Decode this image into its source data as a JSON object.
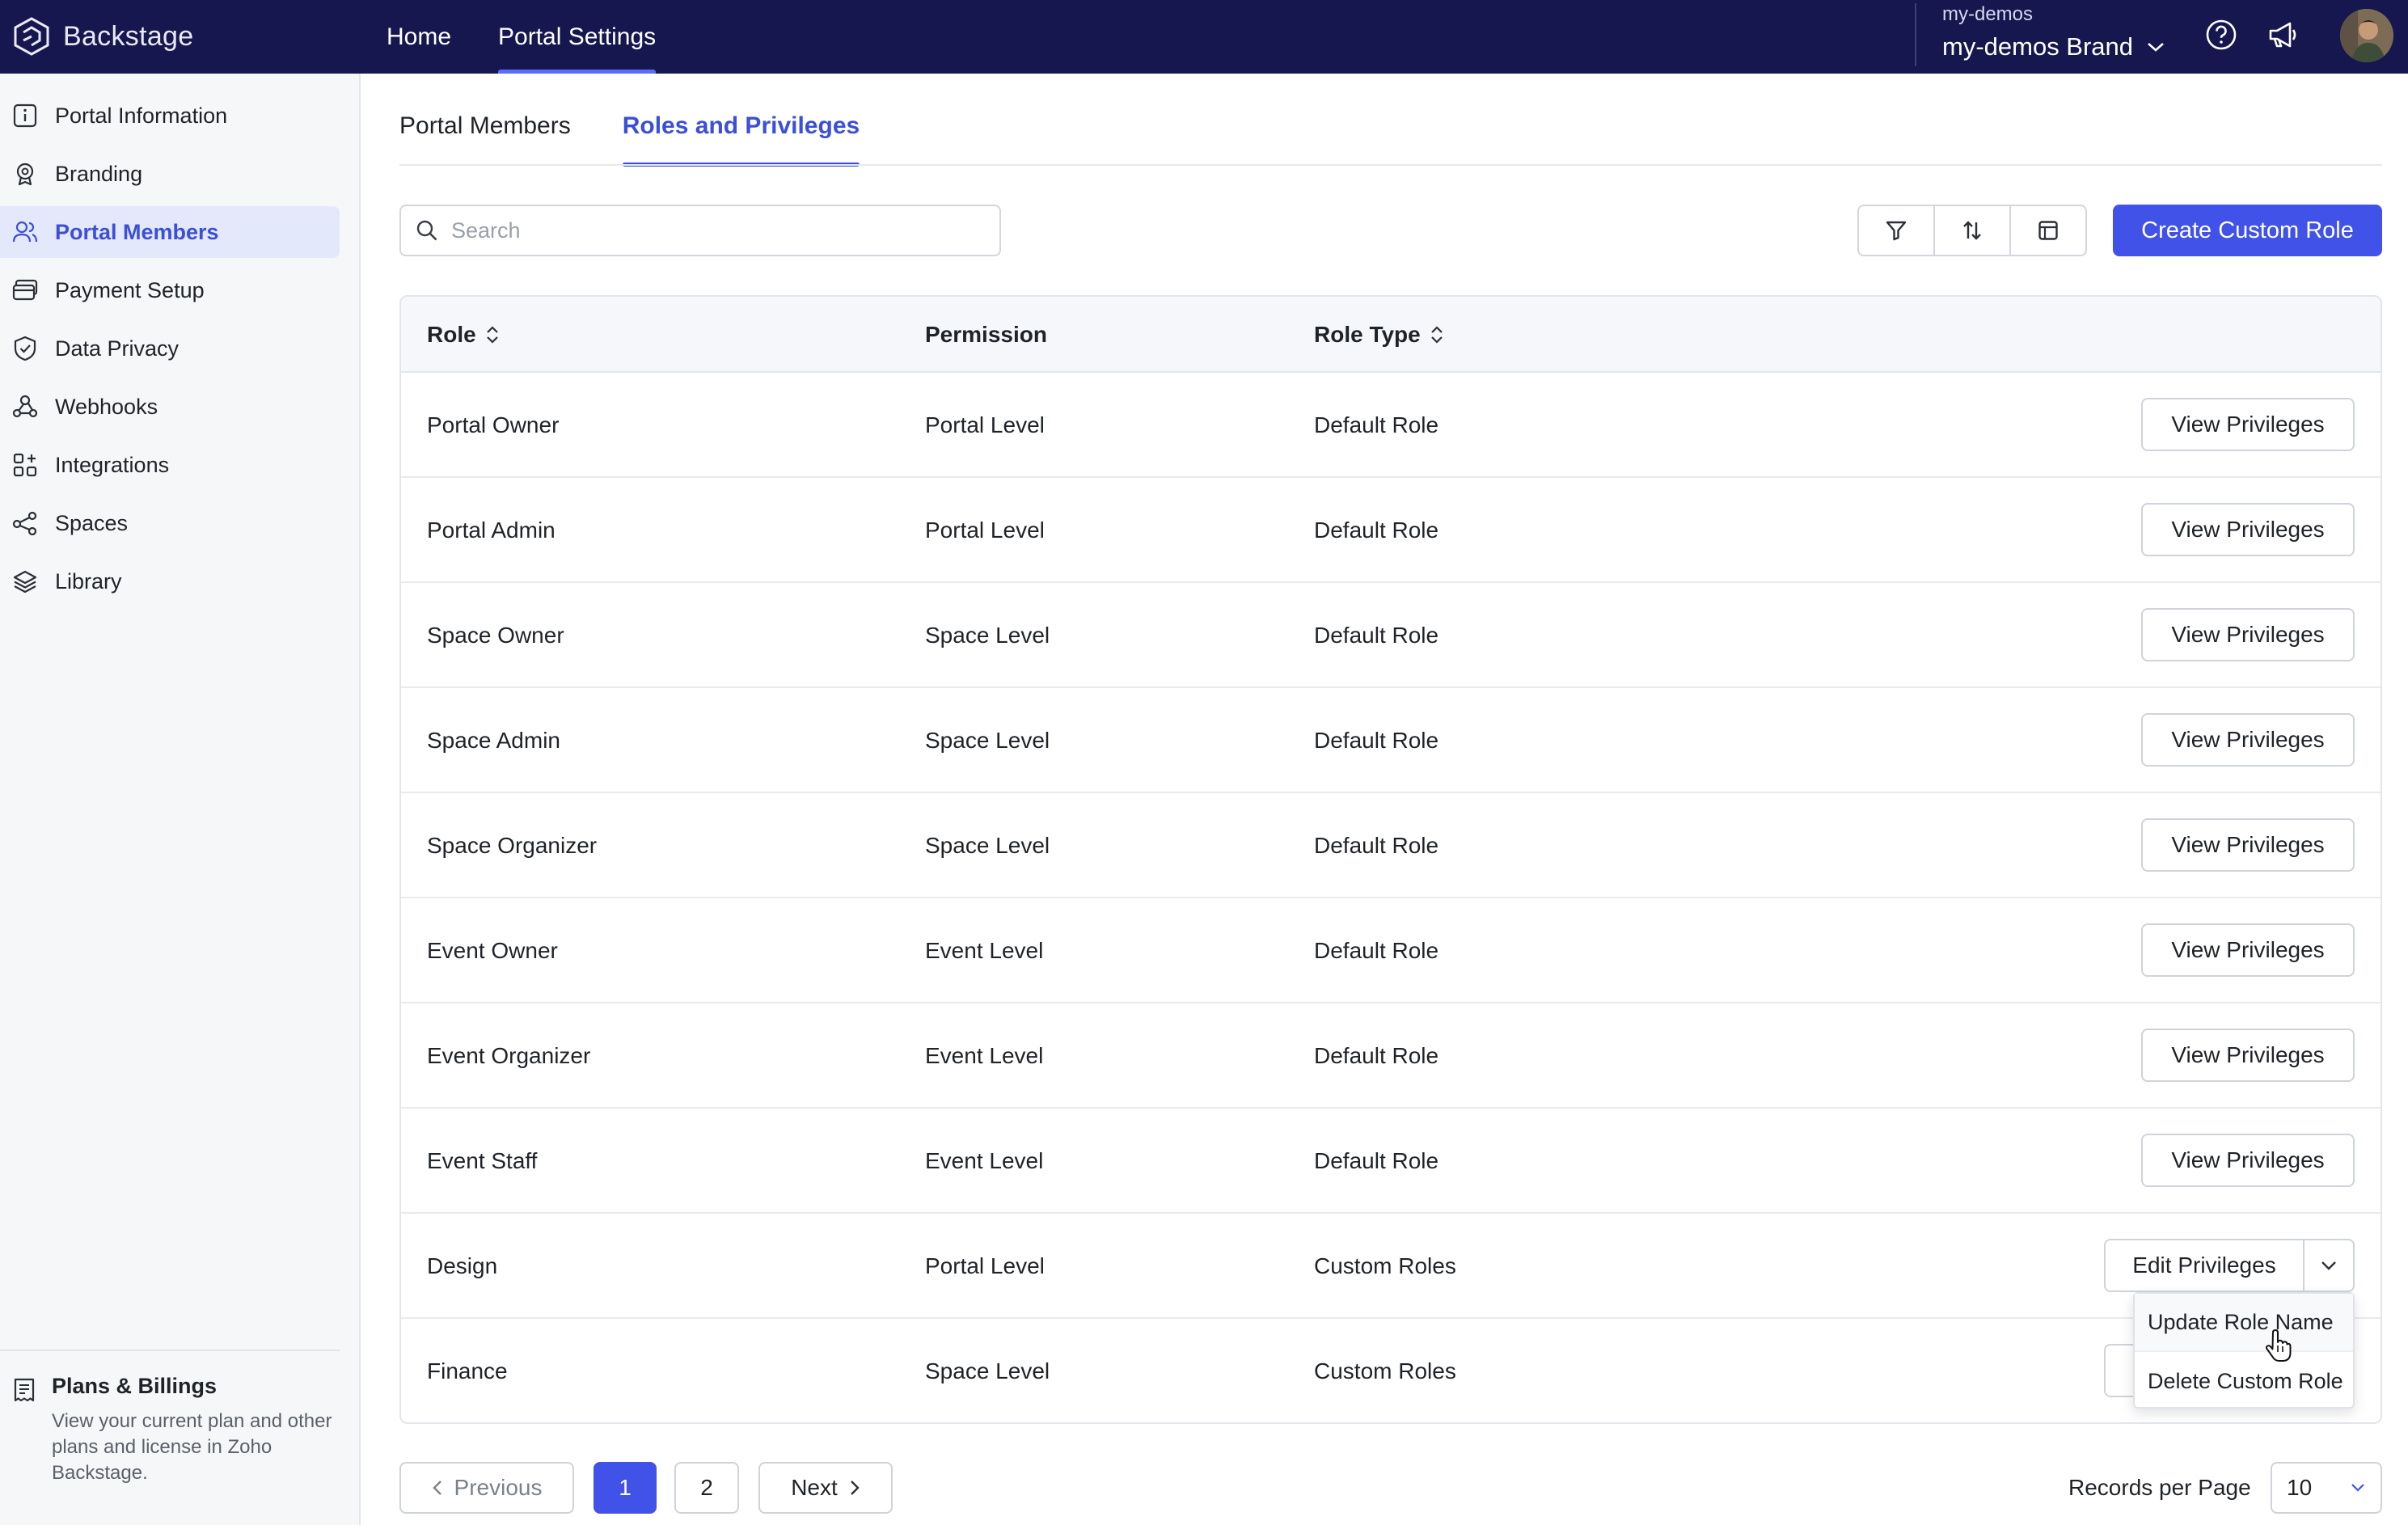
{
  "app": {
    "name": "Backstage"
  },
  "topnav": {
    "items": [
      {
        "label": "Home"
      },
      {
        "label": "Portal Settings"
      }
    ]
  },
  "account": {
    "org": "my-demos",
    "brand": "my-demos Brand"
  },
  "sidebar": {
    "items": [
      {
        "label": "Portal Information",
        "icon": "info-icon"
      },
      {
        "label": "Branding",
        "icon": "badge-icon"
      },
      {
        "label": "Portal Members",
        "icon": "users-icon"
      },
      {
        "label": "Payment Setup",
        "icon": "card-icon"
      },
      {
        "label": "Data Privacy",
        "icon": "shield-icon"
      },
      {
        "label": "Webhooks",
        "icon": "webhook-icon"
      },
      {
        "label": "Integrations",
        "icon": "grid-plus-icon"
      },
      {
        "label": "Spaces",
        "icon": "nodes-icon"
      },
      {
        "label": "Library",
        "icon": "layers-icon"
      }
    ],
    "active_index": 2,
    "plans": {
      "title": "Plans & Billings",
      "description": "View your current plan and other plans and license in Zoho Backstage."
    }
  },
  "tabs": [
    {
      "label": "Portal Members"
    },
    {
      "label": "Roles and Privileges"
    }
  ],
  "search": {
    "placeholder": "Search",
    "value": ""
  },
  "toolbar": {
    "create_label": "Create Custom Role"
  },
  "table": {
    "headers": {
      "role": "Role",
      "permission": "Permission",
      "role_type": "Role Type"
    },
    "rows": [
      {
        "role": "Portal Owner",
        "permission": "Portal Level",
        "role_type": "Default Role",
        "action": "View Privileges"
      },
      {
        "role": "Portal Admin",
        "permission": "Portal Level",
        "role_type": "Default Role",
        "action": "View Privileges"
      },
      {
        "role": "Space Owner",
        "permission": "Space Level",
        "role_type": "Default Role",
        "action": "View Privileges"
      },
      {
        "role": "Space Admin",
        "permission": "Space Level",
        "role_type": "Default Role",
        "action": "View Privileges"
      },
      {
        "role": "Space Organizer",
        "permission": "Space Level",
        "role_type": "Default Role",
        "action": "View Privileges"
      },
      {
        "role": "Event Owner",
        "permission": "Event Level",
        "role_type": "Default Role",
        "action": "View Privileges"
      },
      {
        "role": "Event Organizer",
        "permission": "Event Level",
        "role_type": "Default Role",
        "action": "View Privileges"
      },
      {
        "role": "Event Staff",
        "permission": "Event Level",
        "role_type": "Default Role",
        "action": "View Privileges"
      },
      {
        "role": "Design",
        "permission": "Portal Level",
        "role_type": "Custom Roles",
        "action": "Edit Privileges"
      },
      {
        "role": "Finance",
        "permission": "Space Level",
        "role_type": "Custom Roles",
        "action": ""
      }
    ]
  },
  "dropdown": {
    "items": [
      {
        "label": "Update Role Name"
      },
      {
        "label": "Delete Custom Role"
      }
    ]
  },
  "pagination": {
    "previous": "Previous",
    "next": "Next",
    "pages": [
      "1",
      "2"
    ],
    "current": "1",
    "records_label": "Records per Page",
    "records_value": "10"
  },
  "colors": {
    "topbar": "#16174e",
    "accent": "#4052e8",
    "active_bg": "#e4e8fb"
  }
}
